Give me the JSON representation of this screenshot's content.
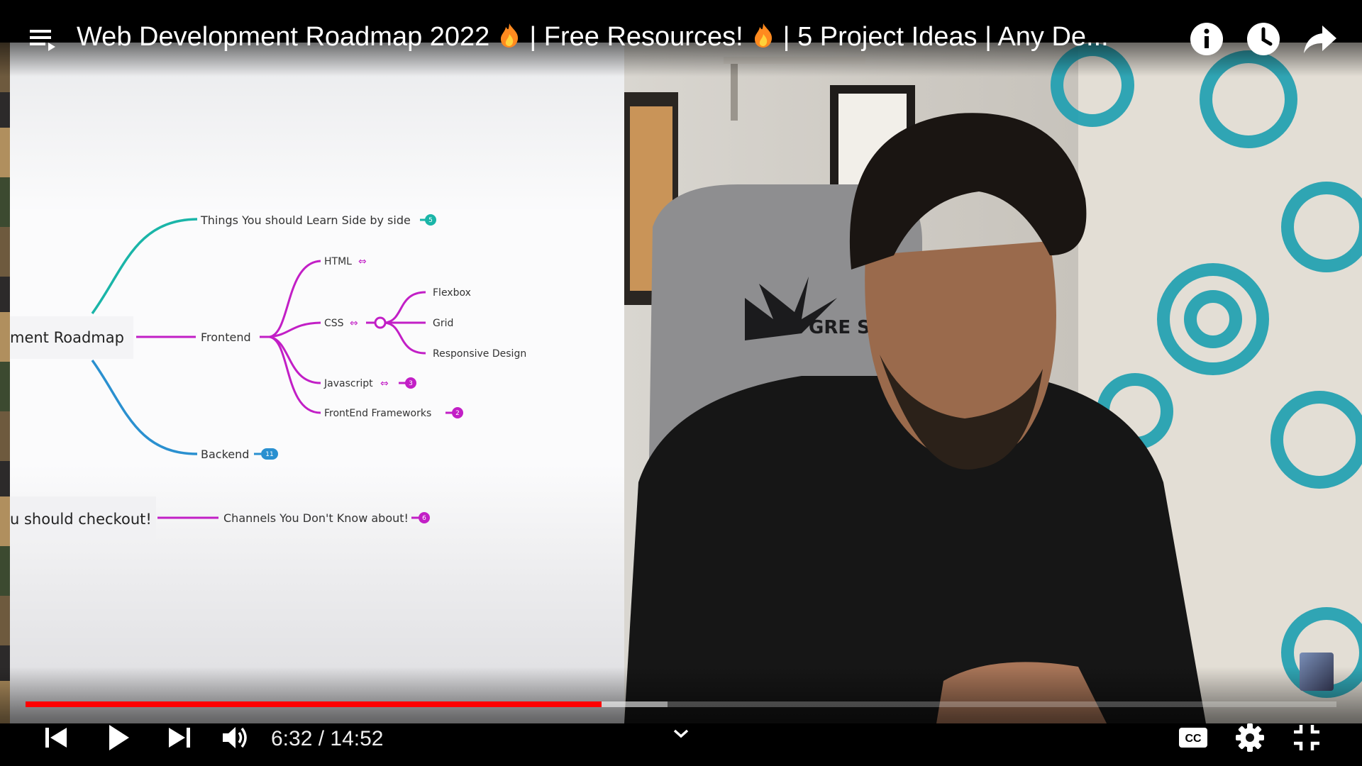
{
  "player": {
    "title": "Web Development Roadmap 2022",
    "title_part2": "| Free Resources!",
    "title_part3": "| 5 Project Ideas | Any De...",
    "current_time": "6:32",
    "duration": "14:52",
    "time_display": "6:32 / 14:52",
    "progress_fraction": 0.4395,
    "buffered_fraction": 0.4895,
    "colors": {
      "progress": "#ff0000",
      "flame": "#ff8a1f"
    }
  },
  "top_controls": [
    "playlist-icon",
    "info-icon",
    "watch-later-clock-icon",
    "share-arrow-icon"
  ],
  "bottom_controls": [
    "previous-icon",
    "play-icon",
    "next-icon",
    "volume-icon",
    "chevron-down-icon",
    "captions-icon",
    "settings-gear-icon",
    "exit-fullscreen-icon"
  ],
  "captions_label": "CC",
  "mindmap": {
    "root": "ment Roadmap",
    "root2": "u should checkout!",
    "learn_side": "Things You should Learn Side by side",
    "learn_side_count": "5",
    "frontend": "Frontend",
    "html": "HTML",
    "css": "CSS",
    "flexbox": "Flexbox",
    "grid": "Grid",
    "responsive": "Responsive Design",
    "javascript": "Javascript",
    "javascript_count": "3",
    "frameworks": "FrontEnd Frameworks",
    "frameworks_count": "2",
    "backend": "Backend",
    "backend_count": "11",
    "channels": "Channels You Don't Know about!",
    "channels_count": "6",
    "colors": {
      "teal": "#1ab5a8",
      "magenta": "#c21fc6",
      "blue": "#2a90d0"
    }
  },
  "scene": {
    "chair_logo": "GRE SOU"
  }
}
